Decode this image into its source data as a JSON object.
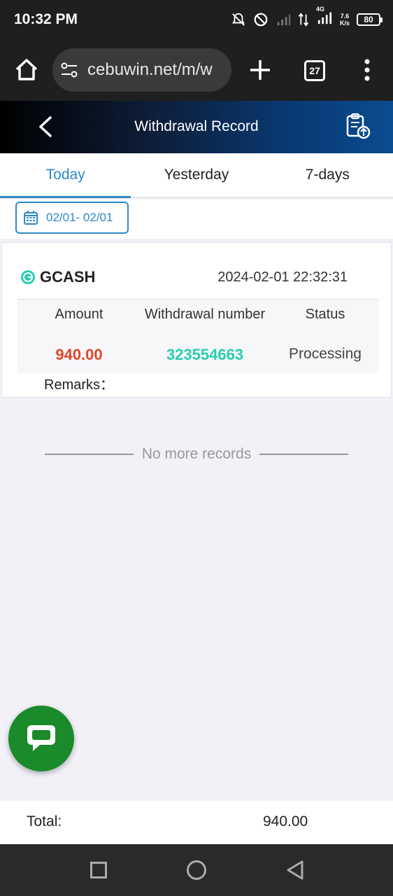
{
  "status_bar": {
    "time": "10:32 PM",
    "network_label": "4G",
    "speed_value": "7.6",
    "speed_unit": "K/s",
    "battery": "80"
  },
  "browser": {
    "url": "cebuwin.net/m/w",
    "tab_count": "27"
  },
  "header": {
    "title": "Withdrawal Record"
  },
  "tabs": [
    {
      "label": "Today",
      "active": true
    },
    {
      "label": "Yesterday",
      "active": false
    },
    {
      "label": "7-days",
      "active": false
    }
  ],
  "date_filter": {
    "range": "02/01- 02/01"
  },
  "record": {
    "method": "GCASH",
    "datetime": "2024-02-01 22:32:31",
    "headers": {
      "amount": "Amount",
      "withdrawal_number": "Withdrawal number",
      "status": "Status"
    },
    "amount": "940.00",
    "withdrawal_number": "323554663",
    "status": "Processing",
    "remarks_label": "Remarks："
  },
  "footer_note": "No more records",
  "total": {
    "label": "Total:",
    "value": "940.00"
  },
  "colors": {
    "accent": "#2e88c9",
    "amount": "#e0462a",
    "withdrawal_number": "#27cfb0",
    "chat": "#1a8a2a"
  }
}
